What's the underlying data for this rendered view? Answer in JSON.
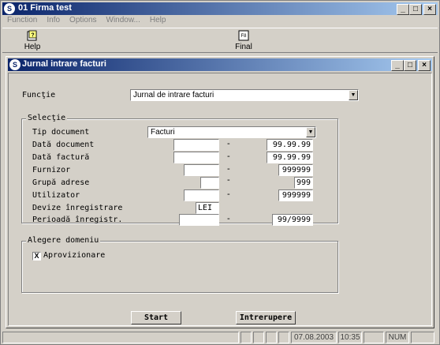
{
  "window": {
    "title": "01  Firma test",
    "controls": {
      "minimize": "_",
      "maximize": "□",
      "close": "×"
    }
  },
  "menu": [
    "Function",
    "Info",
    "Options",
    "Window...",
    "Help"
  ],
  "toolbar": {
    "help_label": "Help",
    "final_label": "Final",
    "final_icon_text": "F8"
  },
  "child": {
    "title": "Jurnal intrare facturi",
    "function_label": "Funcţie",
    "function_value": "Jurnal de intrare facturi",
    "selection": {
      "legend": "Selecţie",
      "tip_document_label": "Tip document",
      "tip_document_value": "Facturi",
      "data_document_label": "Dată document",
      "data_document_from": "",
      "data_document_to": "99.99.99",
      "data_factura_label": "Dată factură",
      "data_factura_from": "",
      "data_factura_to": "99.99.99",
      "furnizor_label": "Furnizor",
      "furnizor_from": "",
      "furnizor_to": "999999",
      "grupa_adrese_label": "Grupă adrese",
      "grupa_adrese_from": "",
      "grupa_adrese_to": "999",
      "utilizator_label": "Utilizator",
      "utilizator_from": "",
      "utilizator_to": "999999",
      "devize_label": "Devize înregistrare",
      "devize_value": "LEI",
      "perioada_label": "Perioadă înregistr.",
      "perioada_from": "",
      "perioada_to": "99/9999",
      "dash": "-"
    },
    "domain": {
      "legend": "Alegere domeniu",
      "aprovizionare_label": "Aprovizionare",
      "aprovizionare_checked": "X"
    },
    "start_label": "Start",
    "intrerupere_label": "Intrerupere"
  },
  "status": {
    "date": "07.08.2003",
    "time": "10:35",
    "num": "NUM"
  }
}
